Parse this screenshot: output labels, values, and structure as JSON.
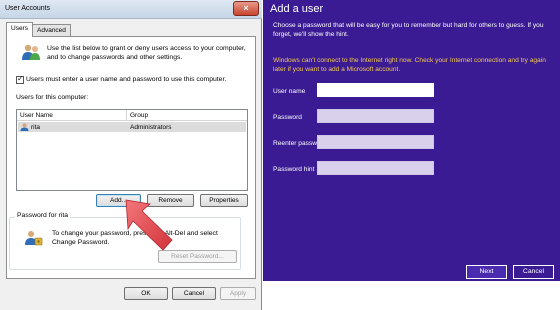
{
  "dialog": {
    "title": "User Accounts",
    "tabs": [
      "Users",
      "Advanced"
    ],
    "intro": "Use the list below to grant or deny users access to your computer, and to change passwords and other settings.",
    "checkbox_label": "Users must enter a user name and password to use this computer.",
    "list_title": "Users for this computer:",
    "columns": [
      "User Name",
      "Group"
    ],
    "rows": [
      {
        "name": "rita",
        "group": "Administrators"
      }
    ],
    "buttons": {
      "add": "Add...",
      "remove": "Remove",
      "properties": "Properties"
    },
    "password_group_title": "Password for rita",
    "password_text": "To change your password, press Ctrl-Alt-Del and select Change Password.",
    "reset_password": "Reset Password...",
    "footer": {
      "ok": "OK",
      "cancel": "Cancel",
      "apply": "Apply"
    }
  },
  "add_user": {
    "title": "Add a user",
    "description": "Choose a password that will be easy for you to remember but hard for others to guess. If you forget, we'll show the hint.",
    "warning": "Windows can't connect to the Internet right now. Check your Internet connection and try again later if you want to add a Microsoft account.",
    "fields": [
      {
        "label": "User name",
        "value": ""
      },
      {
        "label": "Password",
        "value": ""
      },
      {
        "label": "Reenter password",
        "value": ""
      },
      {
        "label": "Password hint",
        "value": ""
      }
    ],
    "next": "Next",
    "cancel": "Cancel"
  },
  "colors": {
    "purple": "#3b1b93",
    "warning": "#f2c94c",
    "arrow": "#e8454a"
  },
  "icons": [
    "users-icon",
    "user-icon",
    "close-icon",
    "password-keys-icon",
    "red-arrow-icon"
  ]
}
